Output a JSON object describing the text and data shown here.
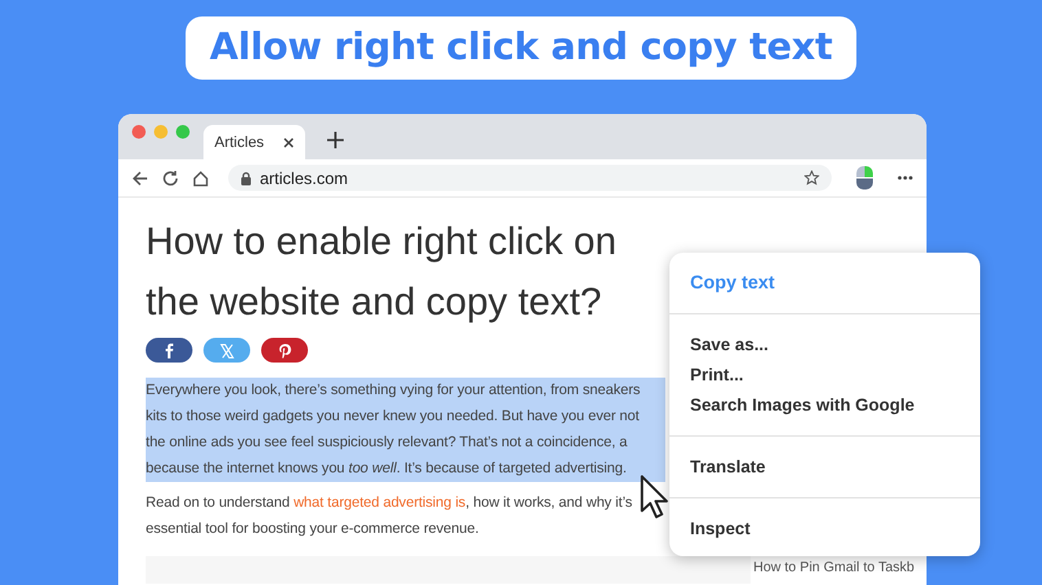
{
  "banner": {
    "title": "Allow right click and copy text"
  },
  "browser": {
    "tabs": [
      {
        "label": "Articles",
        "selected": true
      }
    ],
    "address": "articles.com"
  },
  "article": {
    "headline": [
      "How to enable right click on",
      "the website and copy text?"
    ],
    "share_buttons": [
      {
        "kind": "facebook",
        "color": "#3b5998"
      },
      {
        "kind": "x",
        "color": "#55acee"
      },
      {
        "kind": "pinterest",
        "color": "#c8232c"
      }
    ],
    "paragraphs": [
      {
        "selected": true,
        "lines": [
          "Everywhere you look, there’s something vying for your attention, from sneakers",
          "kits to those weird gadgets you never knew you needed. But have you ever not",
          "the online ads you see feel suspiciously relevant? That’s not a coincidence, a",
          "because the internet knows you *too well*. It’s because of targeted advertising."
        ]
      },
      {
        "selected": false,
        "lines": [
          "Read on to understand ",
          "essential tool for boosting your e-commerce revenue."
        ],
        "link": "what targeted advertising is",
        "after_link": ", how it works, and why it’s"
      }
    ]
  },
  "sidebar": {
    "link": "How to Pin Gmail to Taskb"
  },
  "context_menu": {
    "groups": [
      [
        {
          "label": "Copy text",
          "highlighted": true
        }
      ],
      [
        {
          "label": "Save as...",
          "highlighted": false
        },
        {
          "label": "Print...",
          "highlighted": false
        },
        {
          "label": "Search Images with Google",
          "highlighted": false
        }
      ],
      [
        {
          "label": "Translate",
          "highlighted": false
        }
      ],
      [
        {
          "label": "Inspect",
          "highlighted": false
        }
      ]
    ]
  }
}
